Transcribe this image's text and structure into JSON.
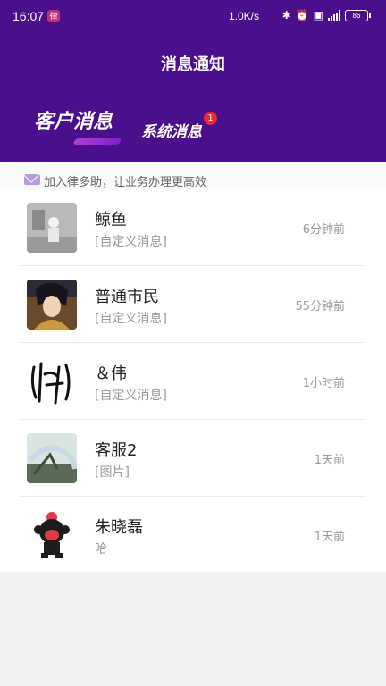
{
  "status_bar": {
    "time": "16:07",
    "app_icon_text": "律",
    "net_speed": "1.0K/s",
    "battery": "86"
  },
  "header": {
    "title": "消息通知"
  },
  "tabs": [
    {
      "label": "客户消息",
      "active": true
    },
    {
      "label": "系统消息",
      "badge": "1"
    }
  ],
  "promo": {
    "text": "加入律多助，让业务办理更高效"
  },
  "messages": [
    {
      "name": "鲸鱼",
      "preview": "[自定义消息]",
      "time": "6分钟前"
    },
    {
      "name": "普通市民",
      "preview": "[自定义消息]",
      "time": "55分钟前"
    },
    {
      "name": "＆伟",
      "preview": "[自定义消息]",
      "time": "1小时前"
    },
    {
      "name": "客服2",
      "preview": "[图片]",
      "time": "1天前"
    },
    {
      "name": "朱晓磊",
      "preview": "哈",
      "time": "1天前"
    }
  ],
  "colors": {
    "header_bg": "#4b0f8e",
    "badge": "#f02a2a",
    "tab_indicator": "#9b30d0"
  }
}
